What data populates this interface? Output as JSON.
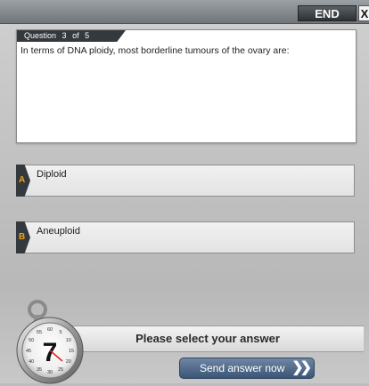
{
  "top_bar": {
    "end_label": "END",
    "close_label": "X"
  },
  "question": {
    "tab_label": "Question",
    "current": "3",
    "of_label": "of",
    "total": "5",
    "text": "In terms of DNA ploidy, most borderline tumours of the ovary are:"
  },
  "answers": [
    {
      "letter": "A",
      "text": "Diploid"
    },
    {
      "letter": "B",
      "text": "Aneuploid"
    }
  ],
  "status": {
    "prompt": "Please select your answer"
  },
  "send_button": {
    "label": "Send answer now"
  },
  "timer": {
    "value": "7",
    "dial_labels": [
      "5",
      "10",
      "15",
      "20",
      "25",
      "30",
      "35",
      "40",
      "45",
      "50",
      "55",
      "60"
    ]
  },
  "colors": {
    "accent_letter": "#f0a21c",
    "dark_tab": "#34393d",
    "send_button": "#4a6384"
  }
}
